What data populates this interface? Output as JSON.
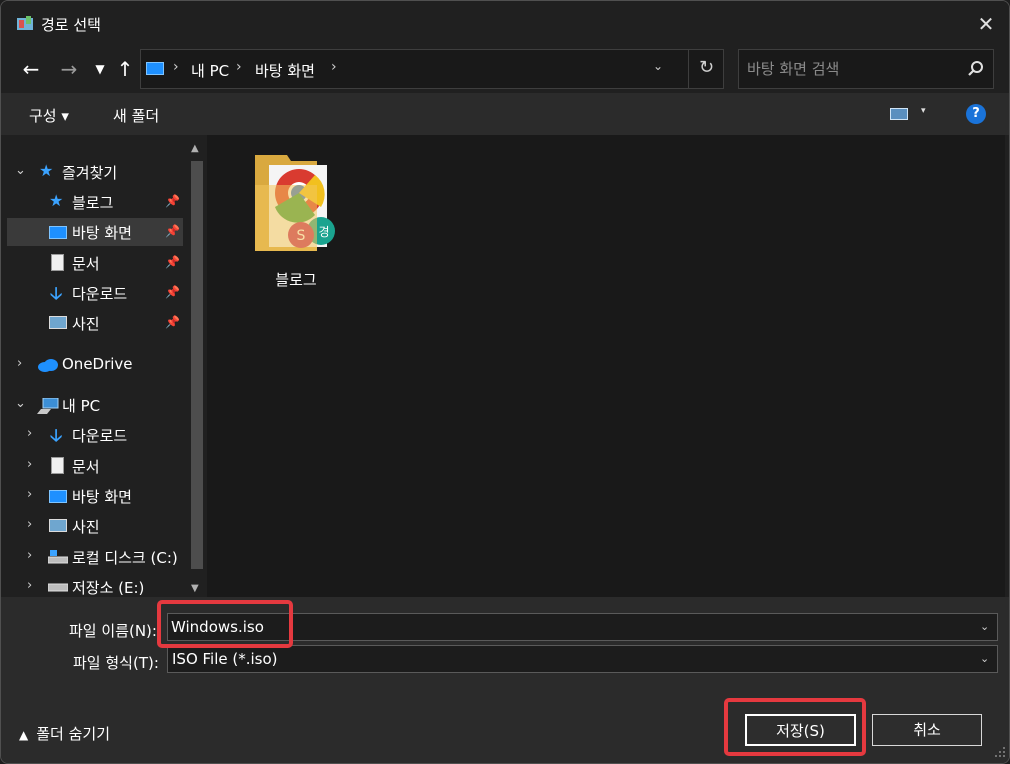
{
  "window": {
    "title": "경로 선택",
    "close_glyph": "✕"
  },
  "nav": {
    "back_glyph": "←",
    "forward_glyph": "→",
    "recent_glyph": "⌄",
    "up_glyph": "↑",
    "breadcrumb": [
      "내 PC",
      "바탕 화면"
    ],
    "crumb_sep": "›",
    "refresh_glyph": "↻",
    "search_placeholder": "바탕 화면 검색"
  },
  "toolbar": {
    "organize": "구성 ▾",
    "new_folder": "새 폴더",
    "view_dd": "▾",
    "help": "?"
  },
  "sidebar": {
    "favorites": {
      "label": "즐겨찾기",
      "items": [
        {
          "label": "블로그",
          "icon": "star-icon",
          "pinned": true
        },
        {
          "label": "바탕 화면",
          "icon": "desktop-icon",
          "pinned": true,
          "selected": true
        },
        {
          "label": "문서",
          "icon": "document-icon",
          "pinned": true
        },
        {
          "label": "다운로드",
          "icon": "download-icon",
          "pinned": true
        },
        {
          "label": "사진",
          "icon": "pictures-icon",
          "pinned": true
        }
      ]
    },
    "onedrive": {
      "label": "OneDrive"
    },
    "this_pc": {
      "label": "내 PC",
      "items": [
        {
          "label": "다운로드",
          "icon": "download-icon"
        },
        {
          "label": "문서",
          "icon": "document-icon"
        },
        {
          "label": "바탕 화면",
          "icon": "desktop-icon"
        },
        {
          "label": "사진",
          "icon": "pictures-icon"
        },
        {
          "label": "로컬 디스크 (C:)",
          "icon": "drive-icon"
        },
        {
          "label": "저장소 (E:)",
          "icon": "drive-icon"
        }
      ]
    },
    "pin_glyph": "📌"
  },
  "content": {
    "items": [
      {
        "label": "블로그",
        "type": "folder",
        "overlay_letters": [
          "S",
          "경"
        ]
      }
    ]
  },
  "form": {
    "filename_label": "파일 이름(N):",
    "filename_value": "Windows.iso",
    "filetype_label": "파일 형식(T):",
    "filetype_value": "ISO File (*.iso)"
  },
  "footer": {
    "hide_folders": "폴더 숨기기",
    "save": "저장(S)",
    "cancel": "취소"
  },
  "colors": {
    "accent": "#1e90ff",
    "highlight": "#e5393f",
    "background": "#202020"
  }
}
